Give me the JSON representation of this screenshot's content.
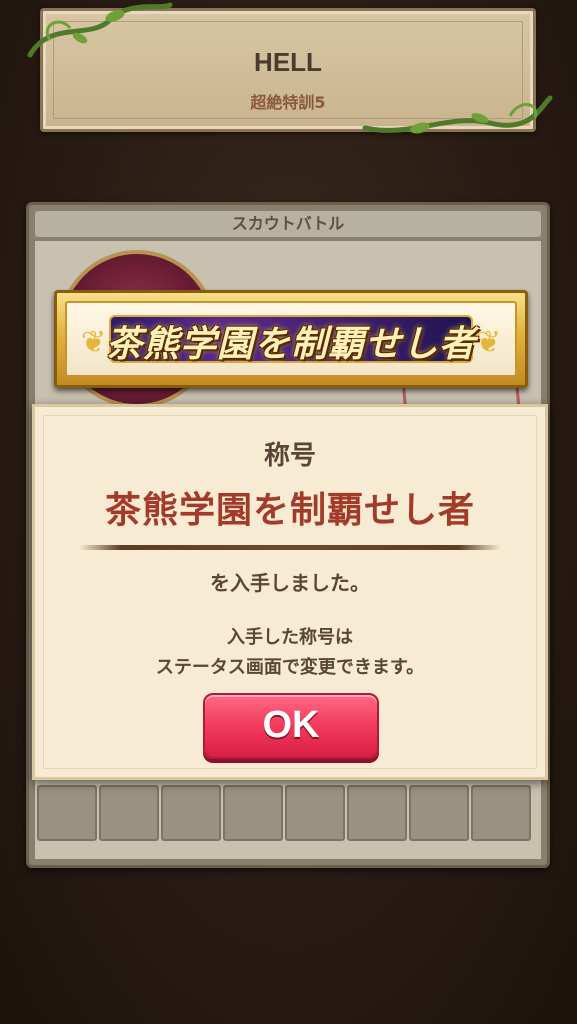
{
  "stage": {
    "title": "HELL",
    "subtitle": "超絶特訓5"
  },
  "panel": {
    "header": "スカウトバトル"
  },
  "banner": {
    "text": "茶熊学園を制覇せし者"
  },
  "dialog": {
    "heading": "称号",
    "title_name": "茶熊学園を制覇せし者",
    "obtained": "を入手しました。",
    "note_line1": "入手した称号は",
    "note_line2": "ステータス画面で変更できます。",
    "ok_label": "OK"
  },
  "colors": {
    "title_red": "#a33b2a",
    "ok_button": "#f23a5c",
    "dialog_bg": "#f7ecd3"
  }
}
